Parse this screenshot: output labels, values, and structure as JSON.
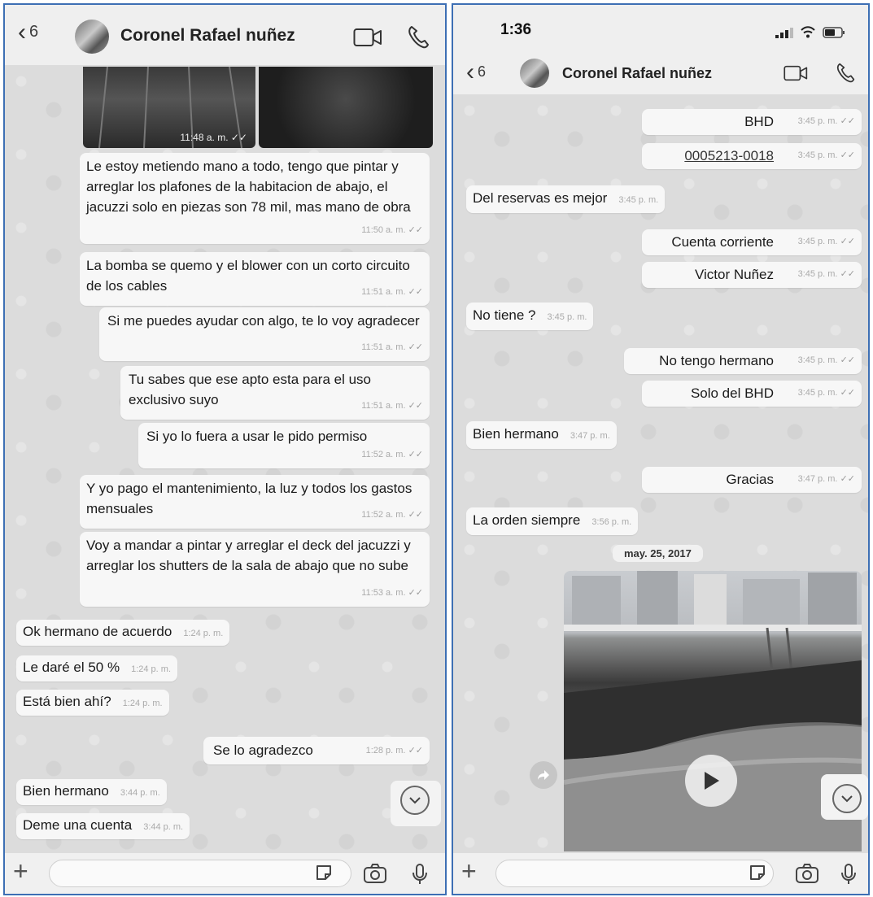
{
  "left": {
    "header": {
      "back_count": "6",
      "contact_name": "Coronel Rafael nuñez"
    },
    "image_time": "11:48 a. m.",
    "messages": [
      {
        "text": "Le estoy metiendo mano a todo, tengo que pintar y arreglar los plafones de la habitacion de abajo, el jacuzzi solo en piezas son 78 mil, mas mano de obra",
        "time": "11:50 a. m."
      },
      {
        "text": "La bomba se quemo y el blower con un corto circuito de los cables",
        "time": "11:51 a. m."
      },
      {
        "text": "Si me puedes ayudar con algo, te lo voy agradecer",
        "time": "11:51 a. m."
      },
      {
        "text": "Tu sabes que ese apto esta para el uso exclusivo suyo",
        "time": "11:51 a. m."
      },
      {
        "text": "Si yo lo fuera a usar le pido permiso",
        "time": "11:52 a. m."
      },
      {
        "text": "Y yo pago el mantenimiento, la luz y todos los gastos mensuales",
        "time": "11:52 a. m."
      },
      {
        "text": "Voy a mandar a pintar y arreglar el deck del jacuzzi y arreglar los shutters de la sala de abajo que no sube",
        "time": "11:53 a. m."
      },
      {
        "text": "Ok hermano de acuerdo",
        "time": "1:24 p. m."
      },
      {
        "text": "Le daré el 50 %",
        "time": "1:24 p. m."
      },
      {
        "text": "Está bien ahí?",
        "time": "1:24 p. m."
      },
      {
        "text": "Se lo agradezco",
        "time": "1:28 p. m."
      },
      {
        "text": "Bien hermano",
        "time": "3:44 p. m."
      },
      {
        "text": "Deme una cuenta",
        "time": "3:44 p. m."
      }
    ],
    "input_placeholder": ""
  },
  "right": {
    "status_time": "1:36",
    "header": {
      "back_count": "6",
      "contact_name": "Coronel Rafael nuñez"
    },
    "messages": [
      {
        "text": "BHD",
        "time": "3:45 p. m."
      },
      {
        "text": "0005213-0018",
        "time": "3:45 p. m."
      },
      {
        "text": "Del reservas es mejor",
        "time": "3:45 p. m."
      },
      {
        "text": "Cuenta corriente",
        "time": "3:45 p. m."
      },
      {
        "text": "Victor Nuñez",
        "time": "3:45 p. m."
      },
      {
        "text": "No tiene ?",
        "time": "3:45 p. m."
      },
      {
        "text": "No tengo hermano",
        "time": "3:45 p. m."
      },
      {
        "text": "Solo del BHD",
        "time": "3:45 p. m."
      },
      {
        "text": "Bien hermano",
        "time": "3:47 p. m."
      },
      {
        "text": "Gracias",
        "time": "3:47 p. m."
      },
      {
        "text": "La orden siempre",
        "time": "3:56 p. m."
      }
    ],
    "date_separator": "may. 25, 2017",
    "input_placeholder": ""
  },
  "colors": {
    "panel_border": "#3d6fb4",
    "chat_background": "#dcdcdc",
    "bubble": "#f7f7f7",
    "timestamp": "#aaaaaa"
  },
  "icons": [
    "back-chevron-icon",
    "video-call-icon",
    "phone-icon",
    "plus-icon",
    "sticker-icon",
    "camera-icon",
    "microphone-icon",
    "scroll-down-icon",
    "play-icon",
    "forward-icon",
    "signal-icon",
    "wifi-icon",
    "battery-icon"
  ]
}
